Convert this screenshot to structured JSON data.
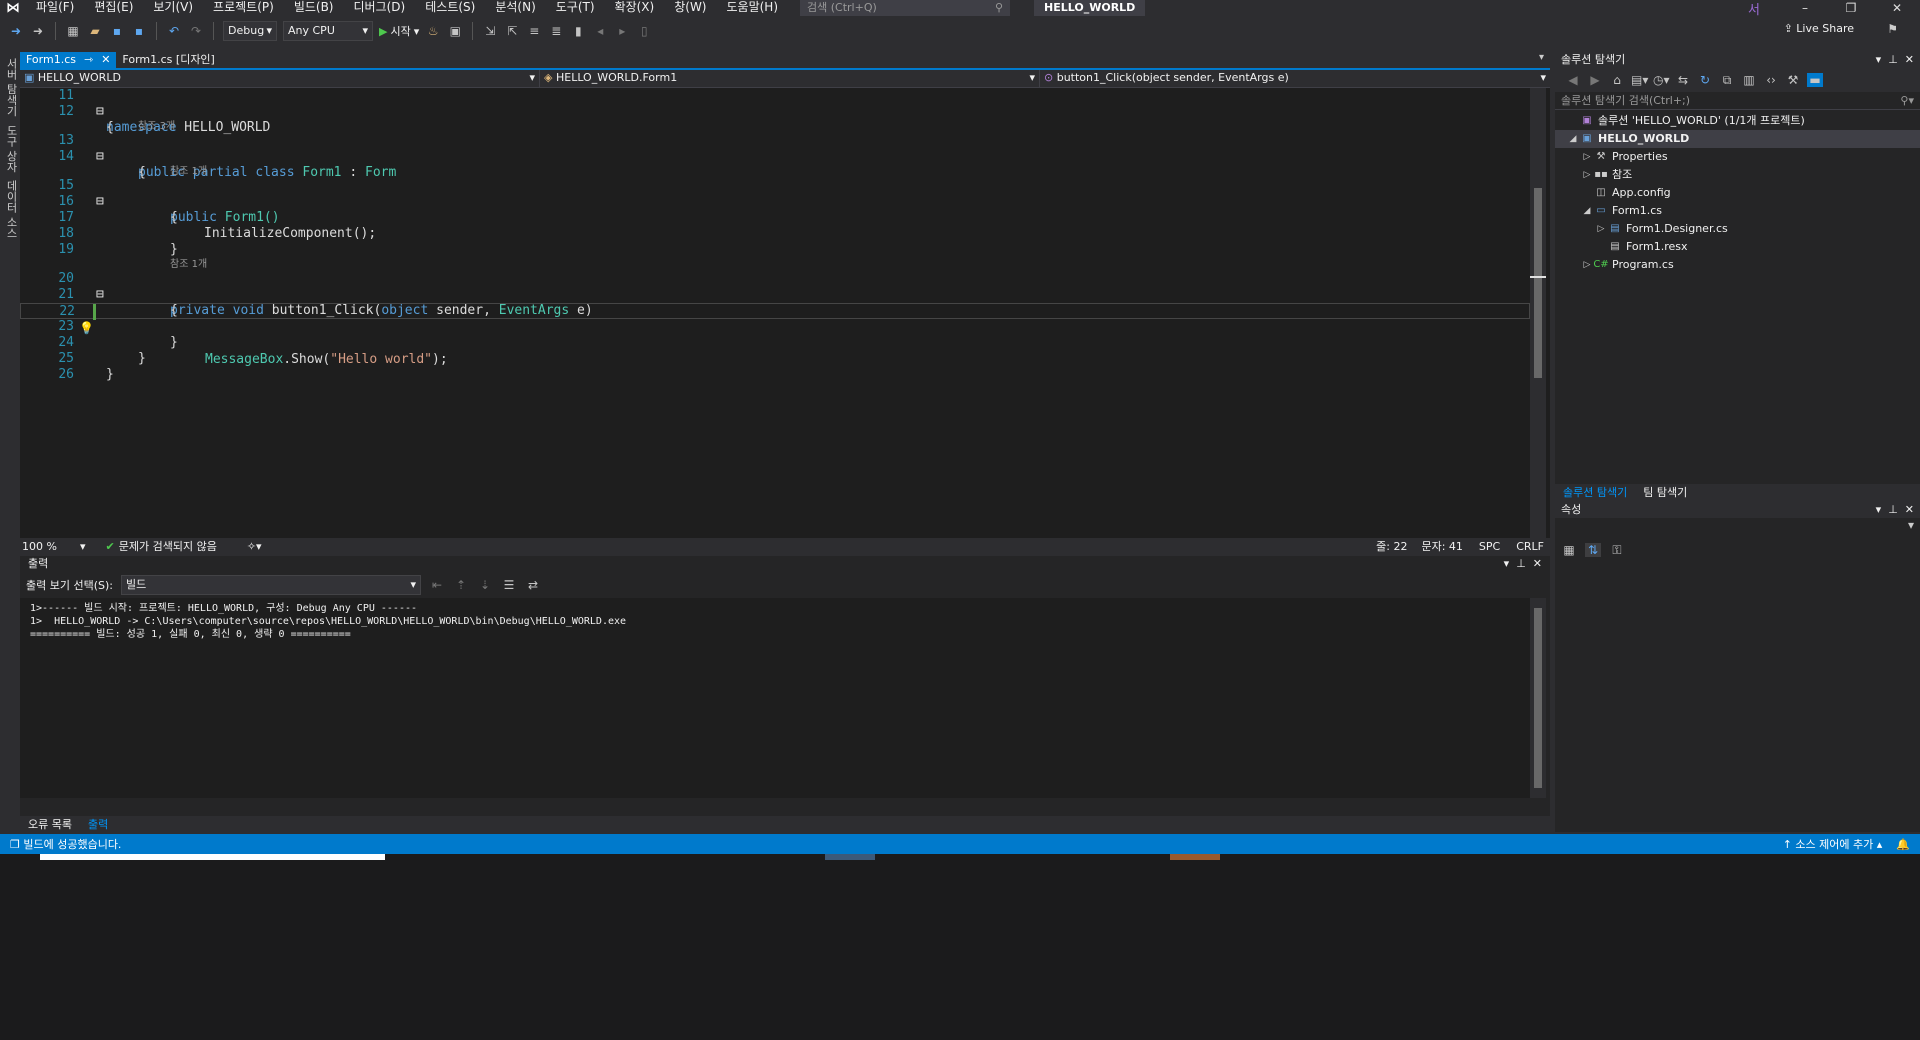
{
  "titlebar": {
    "menus": [
      "파일(F)",
      "편집(E)",
      "보기(V)",
      "프로젝트(P)",
      "빌드(B)",
      "디버그(D)",
      "테스트(S)",
      "분석(N)",
      "도구(T)",
      "확장(X)",
      "창(W)",
      "도움말(H)"
    ],
    "search_placeholder": "검색 (Ctrl+Q)",
    "solution_name": "HELLO_WORLD",
    "user_initial": "서"
  },
  "toolbar": {
    "config": "Debug",
    "platform": "Any CPU",
    "run_label": "시작",
    "live_share": "Live Share"
  },
  "left_strip": {
    "tabs": [
      "서버 탐색기",
      "도구 상자",
      "데이터 소스"
    ]
  },
  "editor": {
    "tabs": [
      {
        "label": "Form1.cs",
        "active": true
      },
      {
        "label": "Form1.cs [디자인]",
        "active": false
      }
    ],
    "nav": {
      "project": "HELLO_WORLD",
      "class": "HELLO_WORLD.Form1",
      "member": "button1_Click(object sender, EventArgs e)"
    },
    "line_numbers": [
      "11",
      "12",
      "13",
      "14",
      "15",
      "16",
      "17",
      "18",
      "19",
      "20",
      "21",
      "22",
      "23",
      "24",
      "25",
      "26"
    ],
    "ref_hints": [
      "참조 3개",
      "참조 1개",
      "참조 1개"
    ],
    "code": {
      "l11_kw": "namespace",
      "l11_name": " HELLO_WORLD",
      "l12": "{",
      "l13_kw": "public partial class",
      "l13_name": " Form1",
      "l13_sep": " : ",
      "l13_base": "Form",
      "l14": "{",
      "l15_kw": "public",
      "l15_name": " Form1()",
      "l16": "{",
      "l17": "InitializeComponent();",
      "l18": "}",
      "l20_kw": "private void",
      "l20_fn": " button1_Click(",
      "l20_kw2": "object",
      "l20_p1": " sender, ",
      "l20_ty": "EventArgs",
      "l20_p2": " e)",
      "l21": "{",
      "l22_ty": "MessageBox",
      "l22_call": ".Show(",
      "l22_str": "\"Hello world\"",
      "l22_end": ");",
      "l23": "}",
      "l24": "}",
      "l25": "}"
    },
    "status": {
      "zoom": "100 %",
      "issues": "문제가 검색되지 않음",
      "line": "줄: 22",
      "col": "문자: 41",
      "spc": "SPC",
      "eol": "CRLF"
    }
  },
  "output": {
    "title": "출력",
    "source_label": "출력 보기 선택(S):",
    "source_value": "빌드",
    "lines": [
      "1>------ 빌드 시작: 프로젝트: HELLO_WORLD, 구성: Debug Any CPU ------",
      "1>  HELLO_WORLD -> C:\\Users\\computer\\source\\repos\\HELLO_WORLD\\HELLO_WORLD\\bin\\Debug\\HELLO_WORLD.exe",
      "========== 빌드: 성공 1, 실패 0, 최신 0, 생략 0 =========="
    ]
  },
  "bottom_tabs": [
    {
      "label": "오류 목록",
      "active": false
    },
    {
      "label": "출력",
      "active": true
    }
  ],
  "solution_explorer": {
    "title": "솔루션 탐색기",
    "search_placeholder": "솔루션 탐색기 검색(Ctrl+;)",
    "tree": [
      {
        "label": "솔루션 'HELLO_WORLD' (1/1개 프로젝트)",
        "level": 0,
        "arrow": "",
        "icon": "sln-icon"
      },
      {
        "label": "HELLO_WORLD",
        "level": 0,
        "arrow": "open",
        "icon": "csproj-icon",
        "selected": true
      },
      {
        "label": "Properties",
        "level": 1,
        "arrow": "closed",
        "icon": "wrench-icon"
      },
      {
        "label": "참조",
        "level": 1,
        "arrow": "closed",
        "icon": "references-icon"
      },
      {
        "label": "App.config",
        "level": 1,
        "arrow": "",
        "icon": "config-icon"
      },
      {
        "label": "Form1.cs",
        "level": 1,
        "arrow": "open",
        "icon": "form-icon"
      },
      {
        "label": "Form1.Designer.cs",
        "level": 2,
        "arrow": "closed",
        "icon": "cs-file-icon"
      },
      {
        "label": "Form1.resx",
        "level": 2,
        "arrow": "",
        "icon": "resx-icon"
      },
      {
        "label": "Program.cs",
        "level": 1,
        "arrow": "closed",
        "icon": "cs-icon"
      }
    ],
    "tabs": [
      {
        "label": "솔루션 탐색기",
        "active": true
      },
      {
        "label": "팀 탐색기",
        "active": false
      }
    ]
  },
  "properties": {
    "title": "속성"
  },
  "statusbar": {
    "message": "빌드에 성공했습니다.",
    "source_control": "소스 제어에 추가"
  },
  "colors": {
    "accent": "#007acc",
    "background": "#2d2d30",
    "editor_bg": "#1e1e1e",
    "keyword": "#569cd6",
    "type": "#4ec9b0",
    "string": "#d69d85",
    "line_number": "#2b91af"
  }
}
